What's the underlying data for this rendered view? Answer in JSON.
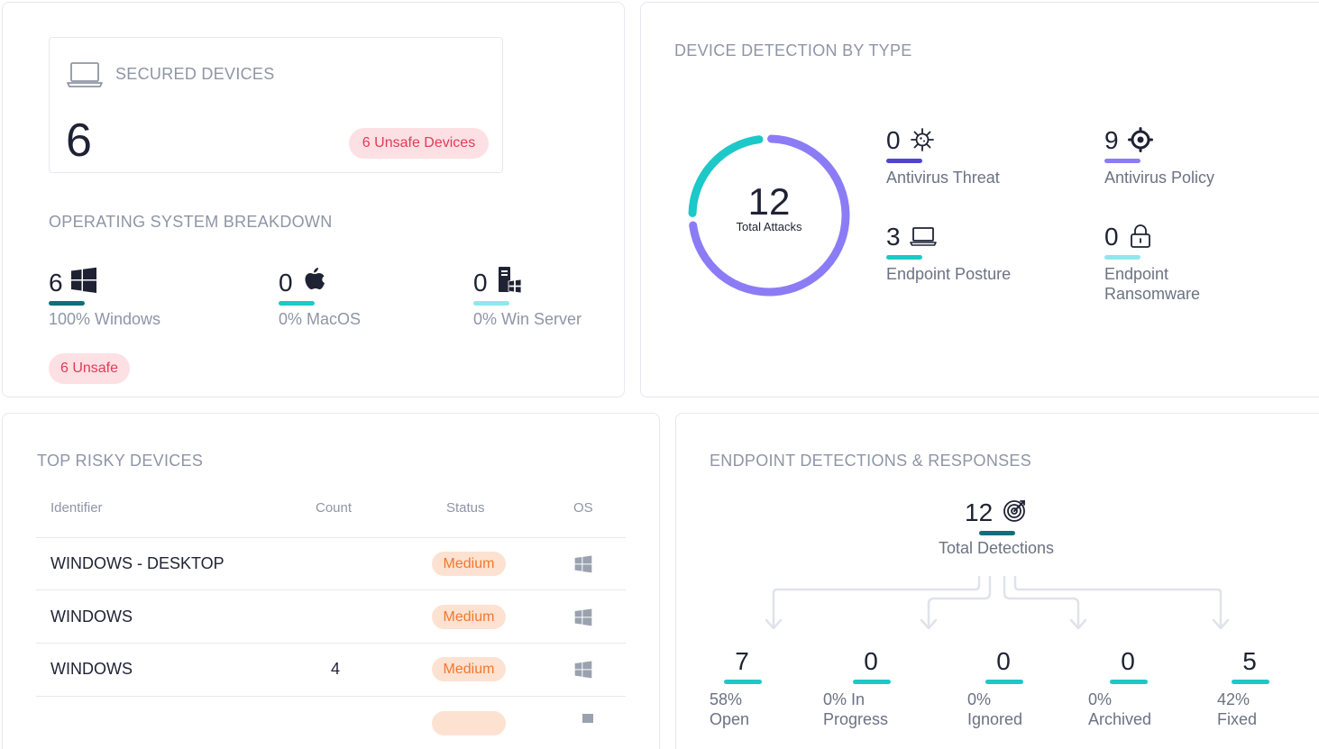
{
  "secured_devices": {
    "title": "SECURED DEVICES",
    "count": "6",
    "unsafe_badge": "6 Unsafe Devices"
  },
  "os_breakdown": {
    "title": "OPERATING SYSTEM BREAKDOWN",
    "items": [
      {
        "count": "6",
        "label": "100% Windows",
        "icon": "windows-icon",
        "color": "#0f6f78"
      },
      {
        "count": "0",
        "label": "0% MacOS",
        "icon": "apple-icon",
        "color": "#1cc8c8"
      },
      {
        "count": "0",
        "label": "0% Win Server",
        "icon": "server-icon",
        "color": "#8de8ee"
      }
    ],
    "unsafe_badge": "6 Unsafe"
  },
  "detection_by_type": {
    "title": "DEVICE DETECTION BY TYPE",
    "total": "12",
    "total_label": "Total Attacks",
    "donut": [
      {
        "name": "Antivirus Threat",
        "value": 0,
        "color": "#5145cd"
      },
      {
        "name": "Antivirus Policy",
        "value": 9,
        "color": "#8b7cf6"
      },
      {
        "name": "Endpoint Posture",
        "value": 3,
        "color": "#1cc8c8"
      },
      {
        "name": "Endpoint Ransomware",
        "value": 0,
        "color": "#8de8ee"
      }
    ],
    "items": [
      {
        "count": "0",
        "label": "Antivirus Threat",
        "icon": "virus-icon",
        "color": "#5145cd"
      },
      {
        "count": "9",
        "label": "Antivirus Policy",
        "icon": "target-icon",
        "color": "#8b7cf6"
      },
      {
        "count": "3",
        "label": "Endpoint Posture",
        "icon": "laptop-icon",
        "color": "#1cc8c8"
      },
      {
        "count": "0",
        "label": "Endpoint Ransomware",
        "icon": "lock-icon",
        "color": "#8de8ee"
      }
    ]
  },
  "top_risky": {
    "title": "TOP RISKY DEVICES",
    "headers": {
      "identifier": "Identifier",
      "count": "Count",
      "status": "Status",
      "os": "OS"
    },
    "rows": [
      {
        "identifier": "WINDOWS - DESKTOP",
        "count": "",
        "status": "Medium",
        "os": "windows-icon"
      },
      {
        "identifier": "WINDOWS",
        "count": "",
        "status": "Medium",
        "os": "windows-icon"
      },
      {
        "identifier": "WINDOWS",
        "count": "4",
        "status": "Medium",
        "os": "windows-icon"
      },
      {
        "identifier": "",
        "count": "",
        "status": "",
        "os": "windows-icon"
      }
    ]
  },
  "edr": {
    "title": "ENDPOINT DETECTIONS & RESPONSES",
    "total": "12",
    "total_label": "Total Detections",
    "items": [
      {
        "count": "7",
        "pct": "58%",
        "label": "Open"
      },
      {
        "count": "0",
        "pct": "0% In",
        "label": "Progress"
      },
      {
        "count": "0",
        "pct": "0%",
        "label": "Ignored"
      },
      {
        "count": "0",
        "pct": "0%",
        "label": "Archived"
      },
      {
        "count": "5",
        "pct": "42%",
        "label": "Fixed"
      }
    ]
  }
}
